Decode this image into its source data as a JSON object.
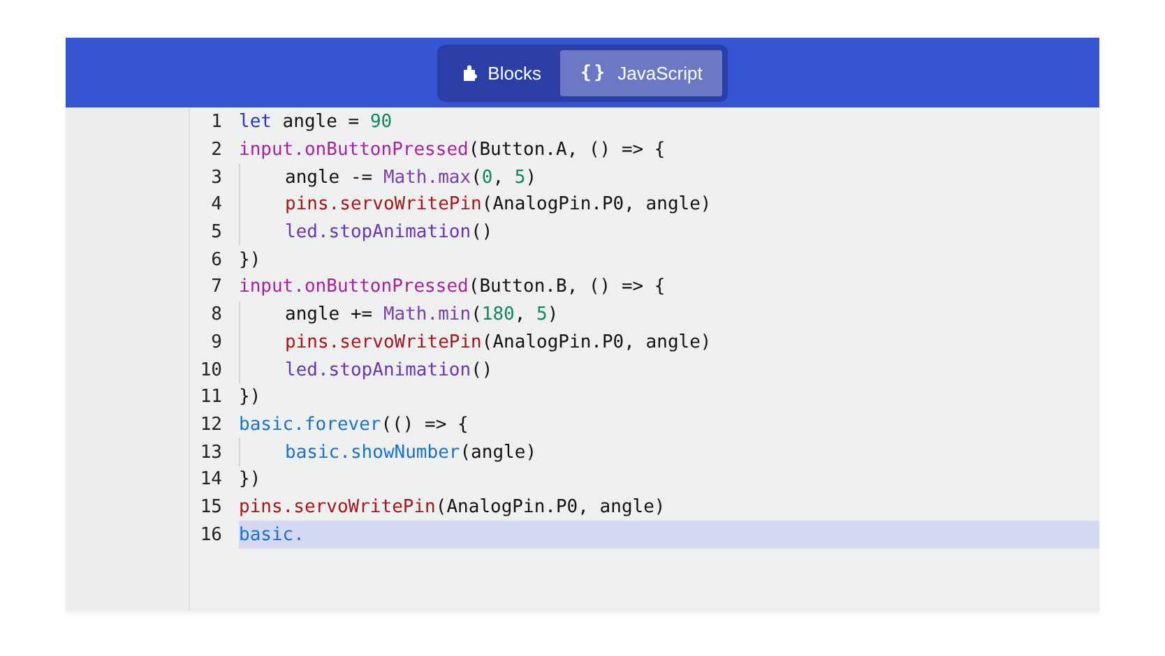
{
  "header": {
    "toggle": [
      {
        "label": "Blocks",
        "selected": false
      },
      {
        "label": "JavaScript",
        "icon_text": "{}",
        "selected": true
      }
    ]
  },
  "editor": {
    "lines": [
      {
        "number": "1",
        "indented": false,
        "selected": false,
        "tokens": [
          {
            "text": "let",
            "kind": "keyword"
          },
          {
            "text": " angle = ",
            "kind": "plain"
          },
          {
            "text": "90",
            "kind": "number"
          }
        ]
      },
      {
        "number": "2",
        "indented": false,
        "selected": false,
        "tokens": [
          {
            "text": "input.onButtonPressed",
            "kind": "input"
          },
          {
            "text": "(Button.A, () => {",
            "kind": "plain"
          }
        ]
      },
      {
        "number": "3",
        "indented": true,
        "selected": false,
        "tokens": [
          {
            "text": "angle -= ",
            "kind": "plain"
          },
          {
            "text": "Math.max",
            "kind": "math"
          },
          {
            "text": "(",
            "kind": "plain"
          },
          {
            "text": "0",
            "kind": "number"
          },
          {
            "text": ", ",
            "kind": "plain"
          },
          {
            "text": "5",
            "kind": "number"
          },
          {
            "text": ")",
            "kind": "plain"
          }
        ]
      },
      {
        "number": "4",
        "indented": true,
        "selected": false,
        "tokens": [
          {
            "text": "pins.servoWritePin",
            "kind": "pins"
          },
          {
            "text": "(AnalogPin.P0, angle)",
            "kind": "plain"
          }
        ]
      },
      {
        "number": "5",
        "indented": true,
        "selected": false,
        "tokens": [
          {
            "text": "led.stopAnimation",
            "kind": "led"
          },
          {
            "text": "()",
            "kind": "plain"
          }
        ]
      },
      {
        "number": "6",
        "indented": false,
        "selected": false,
        "tokens": [
          {
            "text": "})",
            "kind": "plain"
          }
        ]
      },
      {
        "number": "7",
        "indented": false,
        "selected": false,
        "tokens": [
          {
            "text": "input.onButtonPressed",
            "kind": "input"
          },
          {
            "text": "(Button.B, () => {",
            "kind": "plain"
          }
        ]
      },
      {
        "number": "8",
        "indented": true,
        "selected": false,
        "tokens": [
          {
            "text": "angle += ",
            "kind": "plain"
          },
          {
            "text": "Math.min",
            "kind": "math"
          },
          {
            "text": "(",
            "kind": "plain"
          },
          {
            "text": "180",
            "kind": "number"
          },
          {
            "text": ", ",
            "kind": "plain"
          },
          {
            "text": "5",
            "kind": "number"
          },
          {
            "text": ")",
            "kind": "plain"
          }
        ]
      },
      {
        "number": "9",
        "indented": true,
        "selected": false,
        "tokens": [
          {
            "text": "pins.servoWritePin",
            "kind": "pins"
          },
          {
            "text": "(AnalogPin.P0, angle)",
            "kind": "plain"
          }
        ]
      },
      {
        "number": "10",
        "indented": true,
        "selected": false,
        "tokens": [
          {
            "text": "led.stopAnimation",
            "kind": "led"
          },
          {
            "text": "()",
            "kind": "plain"
          }
        ]
      },
      {
        "number": "11",
        "indented": false,
        "selected": false,
        "tokens": [
          {
            "text": "})",
            "kind": "plain"
          }
        ]
      },
      {
        "number": "12",
        "indented": false,
        "selected": false,
        "tokens": [
          {
            "text": "basic.forever",
            "kind": "basic"
          },
          {
            "text": "(() => {",
            "kind": "plain"
          }
        ]
      },
      {
        "number": "13",
        "indented": true,
        "selected": false,
        "tokens": [
          {
            "text": "basic.showNumber",
            "kind": "basic"
          },
          {
            "text": "(angle)",
            "kind": "plain"
          }
        ]
      },
      {
        "number": "14",
        "indented": false,
        "selected": false,
        "tokens": [
          {
            "text": "})",
            "kind": "plain"
          }
        ]
      },
      {
        "number": "15",
        "indented": false,
        "selected": false,
        "tokens": [
          {
            "text": "pins.servoWritePin",
            "kind": "pins"
          },
          {
            "text": "(AnalogPin.P0, angle)",
            "kind": "plain"
          }
        ]
      },
      {
        "number": "16",
        "indented": false,
        "selected": true,
        "tokens": [
          {
            "text": "basic.",
            "kind": "basic"
          }
        ]
      }
    ]
  }
}
